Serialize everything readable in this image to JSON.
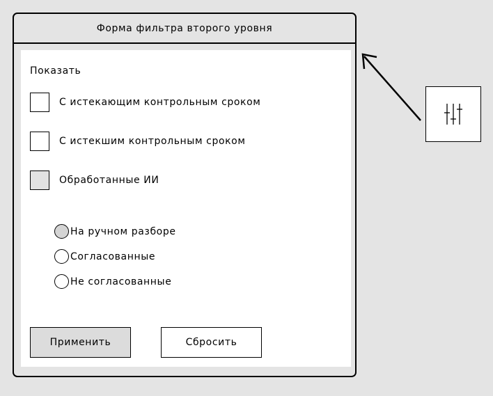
{
  "dialog": {
    "title": "Форма фильтра второго уровня",
    "section_label": "Показать",
    "checkboxes": [
      {
        "label": "С истекающим контрольным сроком",
        "state": "unchecked"
      },
      {
        "label": "С истекшим контрольным сроком",
        "state": "unchecked"
      },
      {
        "label": "Обработанные ИИ",
        "state": "indeterminate"
      }
    ],
    "radios": [
      {
        "label": "На ручном разборе",
        "selected": true
      },
      {
        "label": "Согласованные",
        "selected": false
      },
      {
        "label": "Не согласованные",
        "selected": false
      }
    ],
    "buttons": {
      "apply": "Применить",
      "reset": "Сбросить"
    }
  },
  "filter_button": {
    "icon": "sliders-icon"
  },
  "annotation": {
    "icon": "arrow-icon"
  }
}
